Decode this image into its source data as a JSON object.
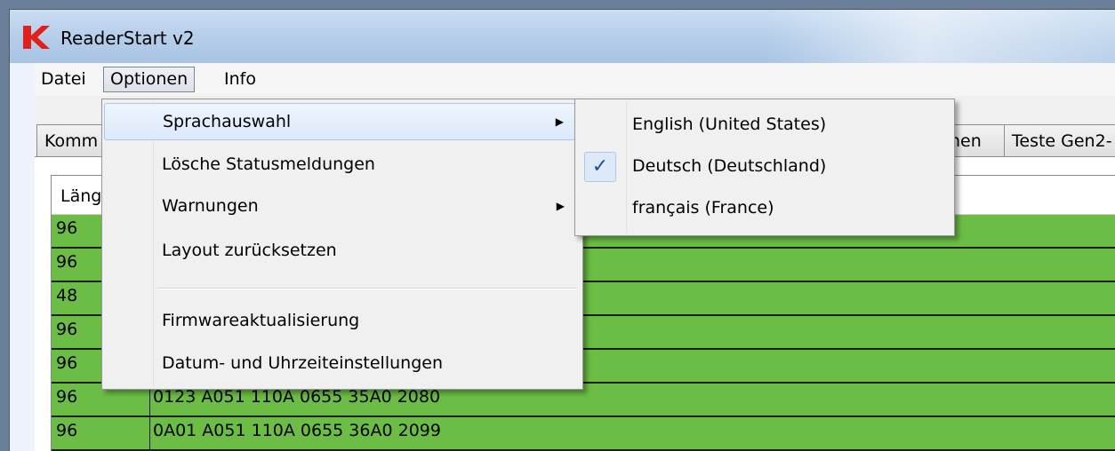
{
  "window": {
    "title": "ReaderStart v2"
  },
  "menubar": {
    "datei": "Datei",
    "optionen": "Optionen",
    "info": "Info"
  },
  "tabs": {
    "left_partial": "Komm",
    "right_partial": "nen",
    "teste_partial": "Teste Gen2-"
  },
  "grid": {
    "header_partial": "Läng",
    "rows": [
      {
        "len": "96",
        "data": ""
      },
      {
        "len": "96",
        "data": ""
      },
      {
        "len": "48",
        "data": ""
      },
      {
        "len": "96",
        "data": ""
      },
      {
        "len": "96",
        "data": ""
      },
      {
        "len": "96",
        "data": "0123 A051 110A 0655 35A0 2080"
      },
      {
        "len": "96",
        "data": "0A01 A051 110A 0655 36A0 2099"
      }
    ]
  },
  "options_menu": {
    "sprachauswahl": "Sprachauswahl",
    "loesche": "Lösche Statusmeldungen",
    "warnungen": "Warnungen",
    "layout": "Layout zurücksetzen",
    "firmware": "Firmwareaktualisierung",
    "datum": "Datum- und Uhrzeiteinstellungen",
    "submenu_arrow": "▶"
  },
  "language_menu": {
    "english": "English (United States)",
    "deutsch": "Deutsch (Deutschland)",
    "francais": "français (France)",
    "check": "✓"
  },
  "colors": {
    "row_green": "#6cbd45",
    "logo_red": "#e0201b"
  }
}
